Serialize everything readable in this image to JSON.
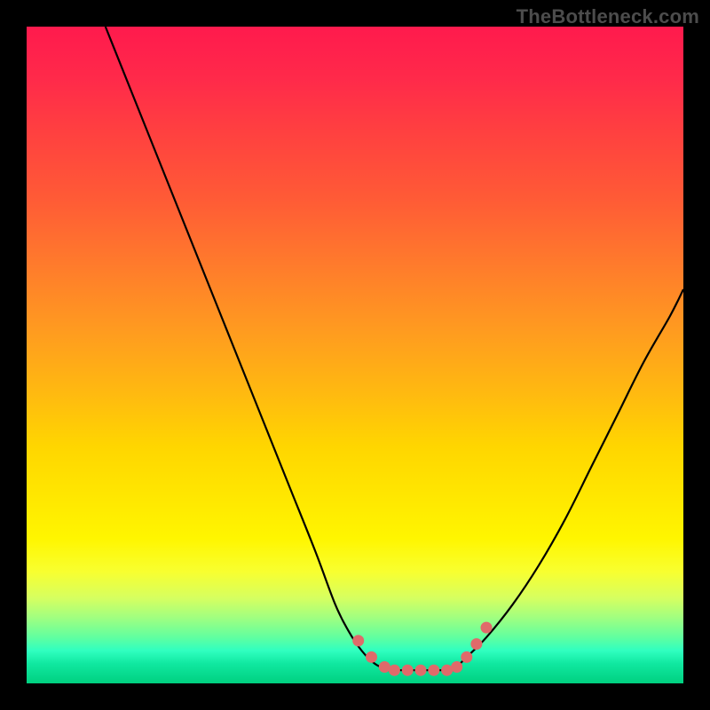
{
  "watermark": "TheBottleneck.com",
  "colors": {
    "frame": "#000000",
    "curve": "#000000",
    "dot": "#e06a6a",
    "grad_top": "#ff1a4d",
    "grad_bottom": "#00d080"
  },
  "chart_data": {
    "type": "line",
    "title": "",
    "xlabel": "",
    "ylabel": "",
    "xlim": [
      0,
      100
    ],
    "ylim": [
      0,
      100
    ],
    "series": [
      {
        "name": "left_curve",
        "x": [
          12,
          16,
          20,
          24,
          28,
          32,
          36,
          40,
          44,
          47,
          49,
          51,
          53,
          55
        ],
        "y": [
          100,
          90,
          80,
          70,
          60,
          50,
          40,
          30,
          20,
          12,
          8,
          5,
          3,
          2
        ]
      },
      {
        "name": "right_curve",
        "x": [
          65,
          67,
          70,
          74,
          78,
          82,
          86,
          90,
          94,
          98,
          100
        ],
        "y": [
          2,
          4,
          7,
          12,
          18,
          25,
          33,
          41,
          49,
          56,
          60
        ]
      }
    ],
    "flat_segment": {
      "x_start": 55,
      "x_end": 65,
      "y": 2
    },
    "dots": [
      {
        "x": 50.5,
        "y": 6.5
      },
      {
        "x": 52.5,
        "y": 4.0
      },
      {
        "x": 54.5,
        "y": 2.5
      },
      {
        "x": 56.0,
        "y": 2.0
      },
      {
        "x": 58.0,
        "y": 2.0
      },
      {
        "x": 60.0,
        "y": 2.0
      },
      {
        "x": 62.0,
        "y": 2.0
      },
      {
        "x": 64.0,
        "y": 2.0
      },
      {
        "x": 65.5,
        "y": 2.5
      },
      {
        "x": 67.0,
        "y": 4.0
      },
      {
        "x": 68.5,
        "y": 6.0
      },
      {
        "x": 70.0,
        "y": 8.5
      }
    ]
  }
}
